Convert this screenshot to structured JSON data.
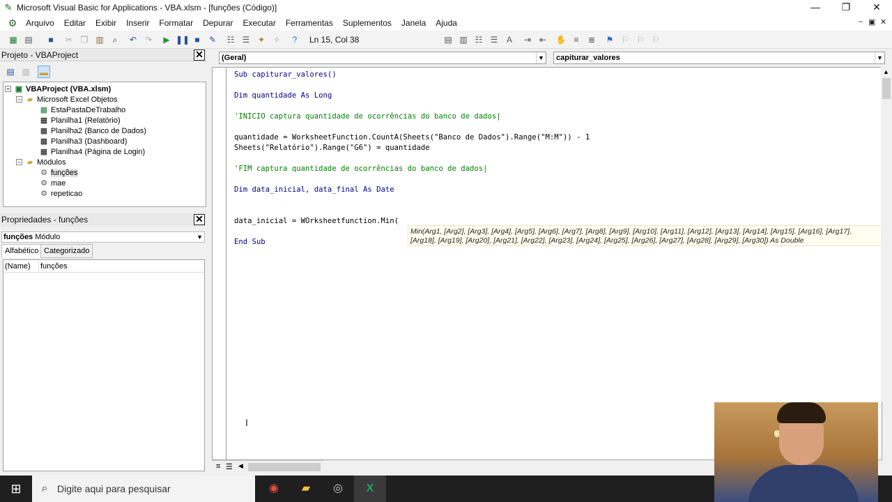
{
  "window": {
    "title": "Microsoft Visual Basic for Applications - VBA.xlsm - [funções (Código)]"
  },
  "menu": [
    "Arquivo",
    "Editar",
    "Exibir",
    "Inserir",
    "Formatar",
    "Depurar",
    "Executar",
    "Ferramentas",
    "Suplementos",
    "Janela",
    "Ajuda"
  ],
  "toolbar": {
    "position": "Ln 15, Col 38"
  },
  "project": {
    "title": "Projeto - VBAProject",
    "root": "VBAProject (VBA.xlsm)",
    "excel_objects_folder": "Microsoft Excel Objetos",
    "excel_objects": [
      "EstaPastaDeTrabalho",
      "Planilha1 (Relatório)",
      "Planilha2 (Banco de Dados)",
      "Planilha3 (Dashboard)",
      "Planilha4 (Página de Login)"
    ],
    "modules_folder": "Módulos",
    "modules": [
      "funções",
      "mae",
      "repeticao"
    ]
  },
  "properties": {
    "title": "Propriedades - funções",
    "object_name": "funções",
    "object_type": "Módulo",
    "tabs": [
      "Alfabético",
      "Categorizado"
    ],
    "row_key": "(Name)",
    "row_value": "funções"
  },
  "code": {
    "object_combo": "(Geral)",
    "proc_combo": "capiturar_valores",
    "lines": {
      "l1": "Sub capiturar_valores()",
      "l2a": "Dim quantidade ",
      "l2b": "As Long",
      "l3": "'INICIO captura quantidade de ocorrências do banco de dados|",
      "l4": "quantidade = WorksheetFunction.CountA(Sheets(\"Banco de Dados\").Range(\"M:M\")) - 1",
      "l5": "Sheets(\"Relatório\").Range(\"G6\") = quantidade",
      "l6": "'FIM captura quantidade de ocorrências do banco de dados|",
      "l7a": "Dim data_inicial, data_final ",
      "l7b": "As Date",
      "l8": "data_inicial = WOrksheetfunction.Min(",
      "l9": "End Sub"
    },
    "tooltip_line1": "Min(Arg1, [Arg2], [Arg3], [Arg4], [Arg5], [Arg6], [Arg7], [Arg8], [Arg9], [Arg10], [Arg11], [Arg12], [Arg13], [Arg14], [Arg15], [Arg16], [Arg17],",
    "tooltip_line2": "[Arg18], [Arg19], [Arg20], [Arg21], [Arg22], [Arg23], [Arg24], [Arg25], [Arg26], [Arg27], [Arg28], [Arg29], [Arg30]) As Double"
  },
  "taskbar": {
    "search_placeholder": "Digite aqui para pesquisar"
  }
}
